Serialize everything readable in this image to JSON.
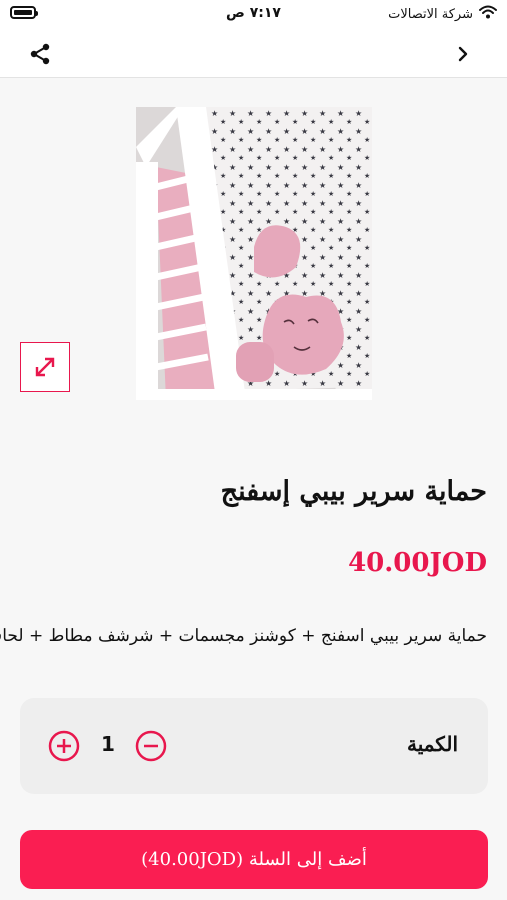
{
  "status_bar": {
    "time": "٧:١٧ ص",
    "carrier": "شركة الاتصالات"
  },
  "nav": {
    "share_icon": "share-icon",
    "back_icon": "chevron-right-icon"
  },
  "product": {
    "title": "حماية سرير بيبي إسفنج",
    "price": "40.00JOD",
    "description": "حماية سرير بيبي اسفنج + كوشنز مجسمات + شرشف مطاط + لحاف"
  },
  "quantity": {
    "label": "الكمية",
    "value": "1"
  },
  "add_to_cart": {
    "label": "أضف إلى السلة (40.00JOD)"
  },
  "colors": {
    "accent": "#e8174d",
    "button": "#fa1e52"
  }
}
